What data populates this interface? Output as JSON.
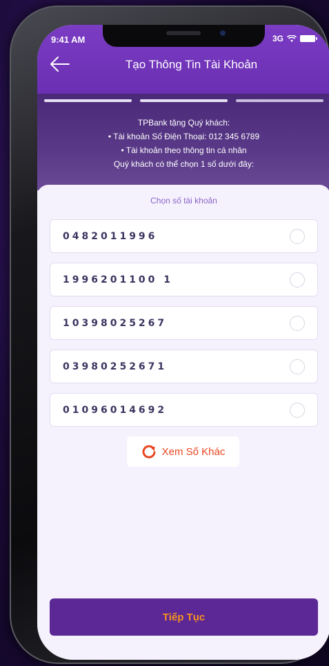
{
  "status_bar": {
    "time": "9:41 AM",
    "network": "3G"
  },
  "header": {
    "title": "Tạo Thông Tin Tài Khoản"
  },
  "promo": {
    "line1": "TPBank tặng Quý khách:",
    "line2": "• Tài khoản Số Điện Thoại: 012 345 6789",
    "line3": "• Tài khoản theo thông tin cá nhân",
    "line4": "Quý khách có thể chọn 1 số dưới đây:"
  },
  "chooser": {
    "label": "Chọn số tài khoản",
    "options": [
      "0482011996",
      "1996201100 1",
      "10398025267",
      "03980252671",
      "01096014692"
    ]
  },
  "more_button": {
    "label": "Xem Số Khác"
  },
  "continue_button": {
    "label": "Tiếp Tục"
  },
  "colors": {
    "brand_purple": "#6a2fb2",
    "accent_orange": "#f7941d",
    "refresh_icon": "#e8451e"
  }
}
